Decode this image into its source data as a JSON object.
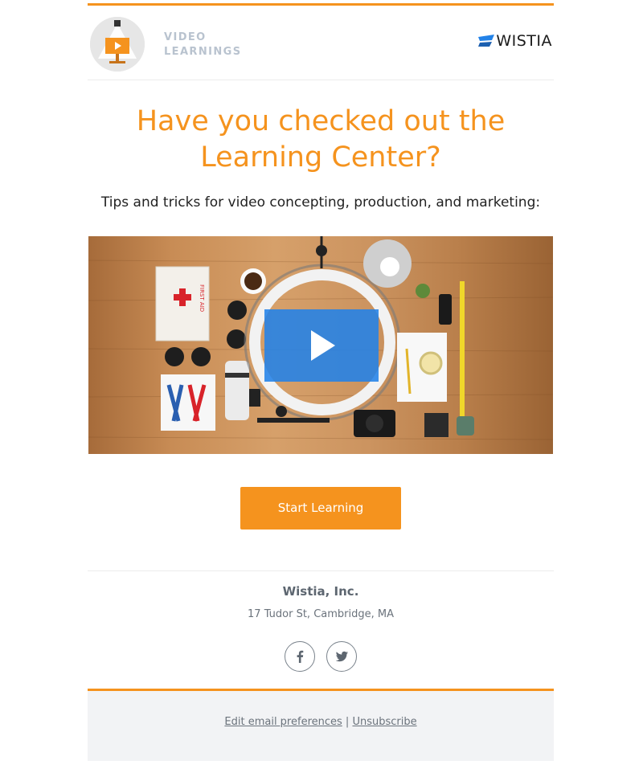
{
  "header": {
    "brand_line1": "VIDEO",
    "brand_line2": "LEARNINGS",
    "logo_text": "WISTIA"
  },
  "headline": {
    "line1": "Have you checked out the",
    "line2": "Learning Center?"
  },
  "subtitle": "Tips and tricks for video concepting, production, and marketing:",
  "video": {
    "first_aid_label": "FIRST AID"
  },
  "cta": {
    "label": "Start Learning"
  },
  "company": {
    "name": "Wistia, Inc.",
    "address": "17 Tudor St, Cambridge, MA"
  },
  "footer": {
    "edit_preferences": "Edit email preferences",
    "separator": "|",
    "unsubscribe": "Unsubscribe"
  },
  "colors": {
    "accent": "#f5931e",
    "play_button": "#2282e8",
    "footer_bg": "#f2f3f5"
  }
}
